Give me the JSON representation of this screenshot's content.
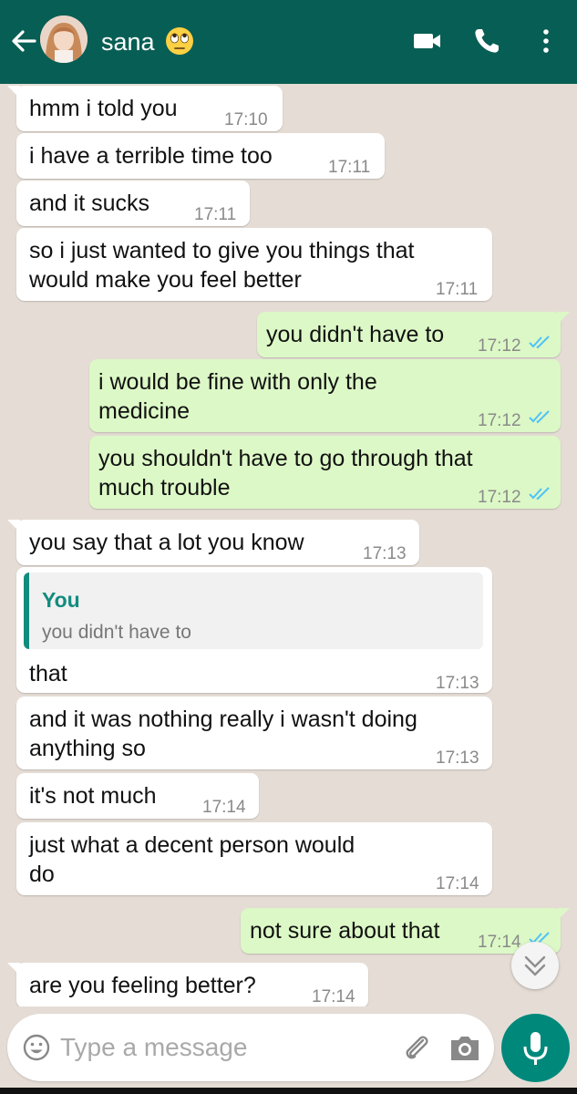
{
  "header": {
    "contact_name": "sana",
    "status_emoji": "🙄",
    "icons": [
      "back-arrow-icon",
      "avatar",
      "video-call-icon",
      "phone-call-icon",
      "more-options-icon"
    ]
  },
  "messages": [
    {
      "dir": "in",
      "lines": [
        "hmm i told you"
      ],
      "time": "17:10"
    },
    {
      "dir": "in",
      "lines": [
        "i have a terrible time too"
      ],
      "time": "17:11"
    },
    {
      "dir": "in",
      "lines": [
        "and it sucks"
      ],
      "time": "17:11"
    },
    {
      "dir": "in",
      "lines": [
        "so i just wanted to give you things that",
        "would make you feel better"
      ],
      "time": "17:11"
    },
    {
      "dir": "out",
      "lines": [
        "you didn't have to"
      ],
      "time": "17:12",
      "read": true
    },
    {
      "dir": "out",
      "lines": [
        "i would be fine with only the",
        "medicine"
      ],
      "time": "17:12",
      "read": true
    },
    {
      "dir": "out",
      "lines": [
        "you shouldn't have to go through that",
        "much trouble"
      ],
      "time": "17:12",
      "read": true
    },
    {
      "dir": "in",
      "lines": [
        "you say that a lot you know"
      ],
      "time": "17:13"
    },
    {
      "dir": "in",
      "lines": [
        "that"
      ],
      "time": "17:13",
      "quote": {
        "author": "You",
        "text": "you didn't have to"
      }
    },
    {
      "dir": "in",
      "lines": [
        "and it was nothing really i wasn't doing",
        "anything so"
      ],
      "time": "17:13"
    },
    {
      "dir": "in",
      "lines": [
        "it's not much"
      ],
      "time": "17:14"
    },
    {
      "dir": "in",
      "lines": [
        "just what a decent person would",
        "do"
      ],
      "time": "17:14"
    },
    {
      "dir": "out",
      "lines": [
        "not sure about that"
      ],
      "time": "17:14",
      "read": true
    },
    {
      "dir": "in",
      "lines": [
        "are you feeling better?"
      ],
      "time": "17:14"
    }
  ],
  "composer": {
    "placeholder": "Type a message",
    "icons": [
      "emoji-icon",
      "attach-icon",
      "camera-icon",
      "microphone-icon"
    ]
  },
  "colors": {
    "header": "#075e54",
    "outgoing_bubble": "#dcf8c6",
    "incoming_bubble": "#ffffff",
    "read_ticks": "#4fc3f7",
    "mic_button": "#00897b",
    "quote_accent": "#128c7e"
  }
}
